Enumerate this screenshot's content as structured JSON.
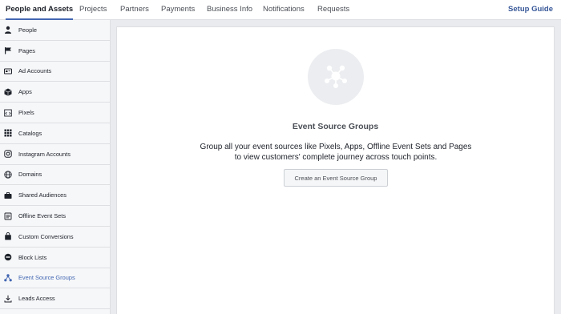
{
  "topnav": {
    "tabs": [
      {
        "label": "People and Assets",
        "active": true
      },
      {
        "label": "Projects"
      },
      {
        "label": "Partners"
      },
      {
        "label": "Payments"
      },
      {
        "label": "Business Info"
      },
      {
        "label": "Notifications"
      },
      {
        "label": "Requests"
      }
    ],
    "setup_guide": "Setup Guide"
  },
  "sidebar": {
    "items": [
      {
        "label": "People",
        "icon": "person-icon"
      },
      {
        "label": "Pages",
        "icon": "flag-icon"
      },
      {
        "label": "Ad Accounts",
        "icon": "ad-accounts-icon"
      },
      {
        "label": "Apps",
        "icon": "cube-icon"
      },
      {
        "label": "Pixels",
        "icon": "pixel-code-icon"
      },
      {
        "label": "Catalogs",
        "icon": "grid-icon"
      },
      {
        "label": "Instagram Accounts",
        "icon": "instagram-icon"
      },
      {
        "label": "Domains",
        "icon": "globe-icon"
      },
      {
        "label": "Shared Audiences",
        "icon": "briefcase-icon"
      },
      {
        "label": "Offline Event Sets",
        "icon": "offline-events-icon"
      },
      {
        "label": "Custom Conversions",
        "icon": "bag-icon"
      },
      {
        "label": "Block Lists",
        "icon": "block-icon"
      },
      {
        "label": "Event Source Groups",
        "icon": "event-source-groups-icon",
        "active": true
      },
      {
        "label": "Leads Access",
        "icon": "download-icon"
      }
    ]
  },
  "main": {
    "icon": "event-source-groups-icon",
    "title": "Event Source Groups",
    "description": "Group all your event sources like Pixels, Apps, Offline Event Sets and Pages to view customers' complete journey across touch points.",
    "cta_label": "Create an Event Source Group"
  },
  "colors": {
    "accent": "#4267b2",
    "link": "#385898",
    "background": "#e9ebee",
    "sidebar_bg": "#f6f7f9",
    "border": "#dddfe2"
  }
}
